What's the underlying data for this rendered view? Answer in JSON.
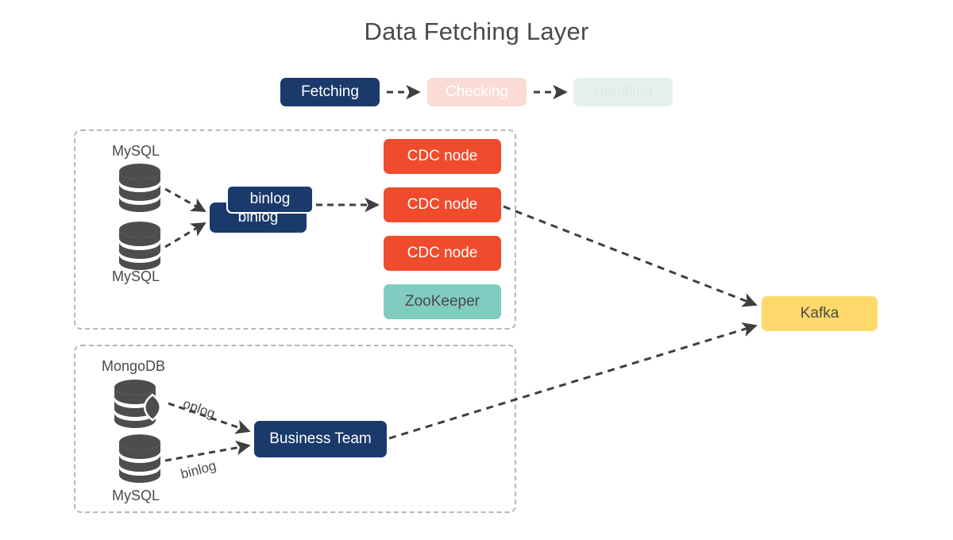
{
  "page": {
    "title": "Data Fetching Layer",
    "background": "#ffffff"
  },
  "colors": {
    "navy": "#1a3a6b",
    "checking_pink": "#fadcd4",
    "handling_mint": "#e4f1ec",
    "cdc_red": "#ef4b2c",
    "zookeeper_teal": "#81ccc0",
    "kafka_yellow": "#ffd96b",
    "db_gray": "#4d4d4d",
    "arrow_gray": "#3f3f3f",
    "dashed_border": "#b6b6b6",
    "text_gray": "#4a4a4a"
  },
  "phases": [
    {
      "label": "Fetching",
      "state": "active"
    },
    {
      "label": "Checking",
      "state": "pending"
    },
    {
      "label": "Handling",
      "state": "pending"
    }
  ],
  "groups": [
    {
      "name": "mysql-cdc-group"
    },
    {
      "name": "mongodb-business-group"
    }
  ],
  "mysql_group": {
    "source_top_label": "MySQL",
    "source_bottom_label": "MySQL",
    "binlog_back_label": "binlog",
    "binlog_front_label": "binlog",
    "nodes": [
      {
        "label": "CDC node",
        "kind": "cdc"
      },
      {
        "label": "CDC node",
        "kind": "cdc"
      },
      {
        "label": "CDC node",
        "kind": "cdc"
      },
      {
        "label": "ZooKeeper",
        "kind": "zookeeper"
      }
    ]
  },
  "mongo_group": {
    "source_top_label": "MongoDB",
    "source_bottom_label": "MySQL",
    "edge_top_label": "oplog",
    "edge_bottom_label": "binlog",
    "target_label": "Business Team"
  },
  "sink": {
    "label": "Kafka"
  }
}
